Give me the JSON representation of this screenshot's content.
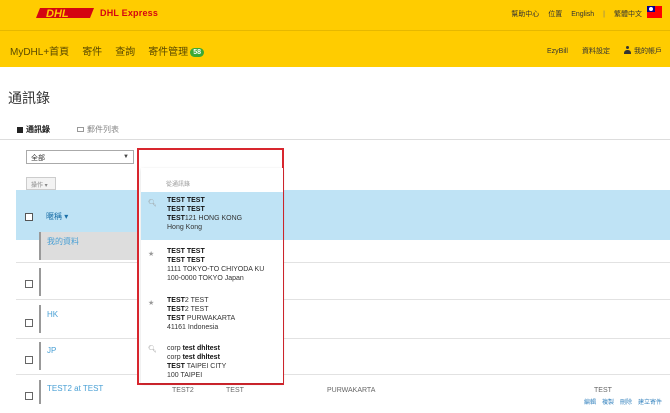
{
  "header": {
    "brand_logo_text": "DHL",
    "brand_sub": "DHL Express",
    "links": [
      "幫助中心",
      "位置",
      "English",
      "|",
      "繁體中文"
    ]
  },
  "nav": {
    "items": [
      {
        "label": "MyDHL+首頁"
      },
      {
        "label": "寄件"
      },
      {
        "label": "查詢"
      },
      {
        "label": "寄件管理",
        "badge": "58"
      }
    ],
    "right": [
      "EzyBill",
      "資料設定",
      "我的帳戶"
    ]
  },
  "page": {
    "title": "通訊錄",
    "tabs": [
      "通訊錄",
      "郵件列表"
    ]
  },
  "filter": {
    "category_value": "全部",
    "search_value": "test"
  },
  "toolbar": {
    "ops_label": "操作 ▾"
  },
  "table": {
    "header_name": "暱稱 ▾",
    "rows": [
      {
        "label": "我的資料"
      },
      {
        "label": ""
      },
      {
        "label": ""
      },
      {
        "label": "HK"
      },
      {
        "label": "JP"
      },
      {
        "label": "TEST2 at TEST",
        "cells": [
          "TEST2",
          "TEST",
          "PURWAKARTA",
          "TEST"
        ]
      }
    ],
    "bottom_links": [
      "編輯",
      "複製",
      "刪除",
      "建立寄件"
    ]
  },
  "dropdown": {
    "header": "從通訊錄",
    "items": [
      {
        "icon": "search-icon",
        "lines": [
          [
            "TEST TEST"
          ],
          [
            "TEST TEST"
          ],
          [
            "TEST",
            "121 HONG KONG"
          ],
          [
            "",
            "Hong Kong"
          ]
        ]
      },
      {
        "icon": "star-icon",
        "lines": [
          [
            "TEST TEST"
          ],
          [
            "TEST TEST"
          ],
          [
            "",
            "1111 TOKYO-TO CHIYODA KU"
          ],
          [
            "",
            "100-0000 TOKYO Japan"
          ]
        ]
      },
      {
        "icon": "star-icon",
        "lines": [
          [
            "TEST",
            "2 TEST"
          ],
          [
            "TEST",
            "2 TEST"
          ],
          [
            "TEST",
            " PURWAKARTA"
          ],
          [
            "",
            "41161 Indonesia"
          ]
        ]
      },
      {
        "icon": "search-icon",
        "lines": [
          [
            "corp ",
            "test dhltest"
          ],
          [
            "corp ",
            "test dhltest"
          ],
          [
            "TEST",
            " TAIPEI CITY"
          ],
          [
            "",
            "100 TAIPEI"
          ]
        ]
      }
    ]
  },
  "colors": {
    "dhl_yellow": "#ffcc00",
    "dhl_red": "#d40511",
    "highlight_blue": "#bfe3f5",
    "focus_border": "#d8262e"
  }
}
